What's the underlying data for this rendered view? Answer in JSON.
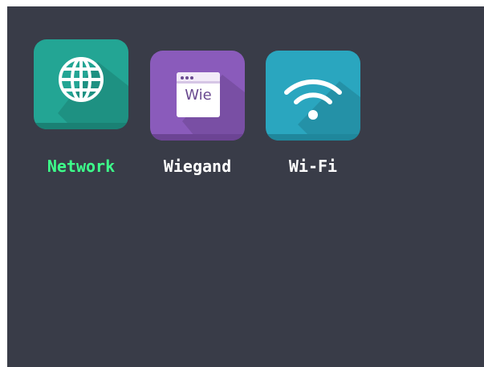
{
  "apps": [
    {
      "id": "network",
      "label": "Network",
      "icon": "globe-icon",
      "selected": true,
      "tile_color": "#23a594",
      "tile_shade": "#1a8174",
      "label_color": "#3dff8a"
    },
    {
      "id": "wiegand",
      "label": "Wiegand",
      "icon": "wiegand-window-icon",
      "icon_text": "Wie",
      "selected": false,
      "tile_color": "#8a5bbb",
      "tile_shade": "#6c4494",
      "label_color": "#ffffff"
    },
    {
      "id": "wifi",
      "label": "Wi-Fi",
      "icon": "wifi-icon",
      "selected": false,
      "tile_color": "#2aa6bf",
      "tile_shade": "#1f879c",
      "label_color": "#ffffff"
    }
  ]
}
